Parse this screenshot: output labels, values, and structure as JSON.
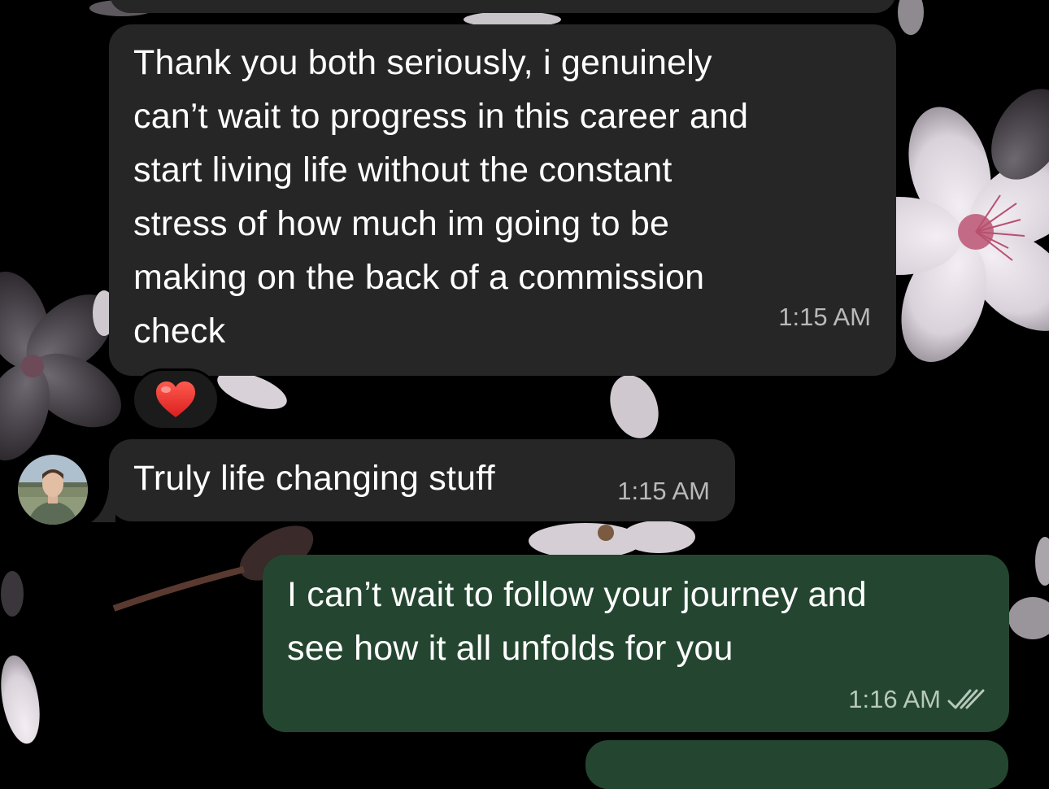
{
  "messages": [
    {
      "id": "m1",
      "direction": "incoming",
      "text": "Thank you both seriously, i genuinely\ncan’t wait to progress in this career and\nstart living life without the constant\nstress of how much im going to be\nmaking on the back of a commission\ncheck",
      "time": "1:15 AM",
      "reaction": "❤️"
    },
    {
      "id": "m2",
      "direction": "incoming",
      "text": "Truly life changing stuff",
      "time": "1:15 AM",
      "sender_avatar": "profile-photo"
    },
    {
      "id": "m3",
      "direction": "outgoing",
      "text": "I can’t wait to follow your journey and\nsee how it all unfolds for you",
      "time": "1:16 AM",
      "status_icon": "double-check-read-icon"
    }
  ],
  "theme": {
    "incoming_bubble": "#262626",
    "outgoing_bubble": "#244630",
    "background": "#000000",
    "wallpaper": "cherry-blossom"
  }
}
